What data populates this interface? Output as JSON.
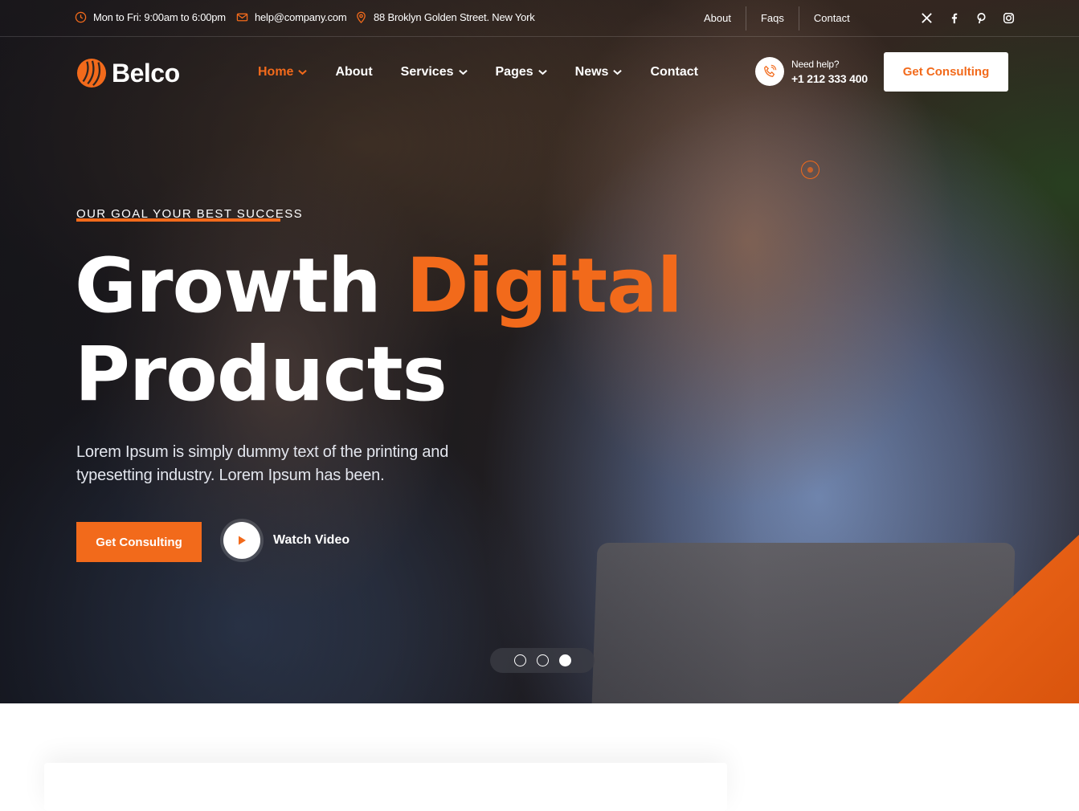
{
  "topbar": {
    "hours": "Mon to Fri: 9:00am to 6:00pm",
    "email": "help@company.com",
    "address": "88 Broklyn Golden Street. New York",
    "links": [
      "About",
      "Faqs",
      "Contact"
    ],
    "socials": [
      "x-icon",
      "facebook-icon",
      "pinterest-icon",
      "instagram-icon"
    ]
  },
  "header": {
    "brand": "Belco",
    "nav": [
      {
        "label": "Home",
        "active": true,
        "dropdown": true
      },
      {
        "label": "About",
        "active": false,
        "dropdown": false
      },
      {
        "label": "Services",
        "active": false,
        "dropdown": true
      },
      {
        "label": "Pages",
        "active": false,
        "dropdown": true
      },
      {
        "label": "News",
        "active": false,
        "dropdown": true
      },
      {
        "label": "Contact",
        "active": false,
        "dropdown": false
      }
    ],
    "help_label": "Need help?",
    "help_phone": "+1 212 333 400",
    "cta": "Get Consulting"
  },
  "hero": {
    "eyebrow": "OUR GOAL YOUR BEST SUCCESS",
    "headline_white": "Growth",
    "headline_accent": "Digital",
    "headline_line2": "Products",
    "description": "Lorem Ipsum is simply dummy text of the printing and typesetting industry. Lorem Ipsum has been.",
    "cta": "Get Consulting",
    "video_label": "Watch Video",
    "slides_total": 3,
    "slide_active": 3
  },
  "colors": {
    "accent": "#f26a1b",
    "text_light": "#ffffff"
  }
}
